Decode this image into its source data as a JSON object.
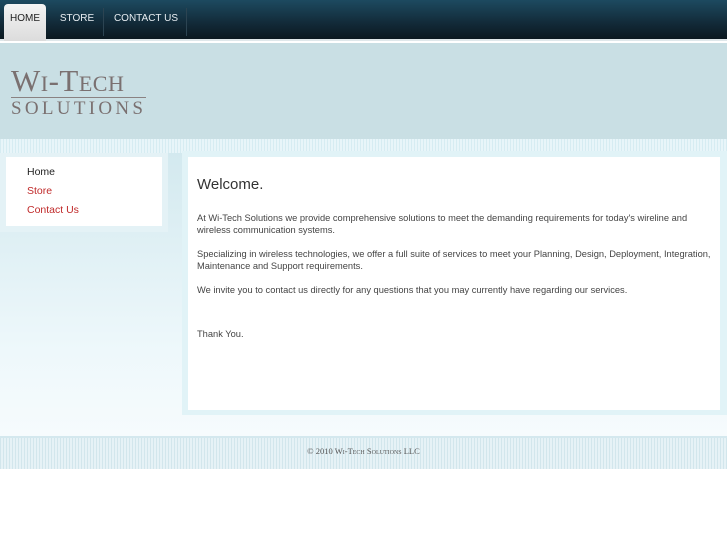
{
  "nav": {
    "items": [
      {
        "label": "HOME"
      },
      {
        "label": "STORE"
      },
      {
        "label": "CONTACT US"
      }
    ]
  },
  "logo": {
    "line1": "Wi-Tech",
    "line2": "SOLUTIONS"
  },
  "sidebar": {
    "items": [
      {
        "label": "Home"
      },
      {
        "label": "Store"
      },
      {
        "label": "Contact Us"
      }
    ]
  },
  "content": {
    "title": "Welcome.",
    "paragraphs": [
      "At Wi-Tech Solutions we provide comprehensive solutions to meet the demanding requirements for today's wireline and wireless communication systems.",
      "Specializing in wireless technologies, we offer a full suite of services to meet your Planning, Design, Deployment, Integration, Maintenance and Support requirements.",
      "We invite you to contact us directly for any questions that you may currently have regarding our services."
    ],
    "closing": "Thank You."
  },
  "footer": {
    "copyright": "© 2010 Wi-Tech Solutions LLC"
  }
}
